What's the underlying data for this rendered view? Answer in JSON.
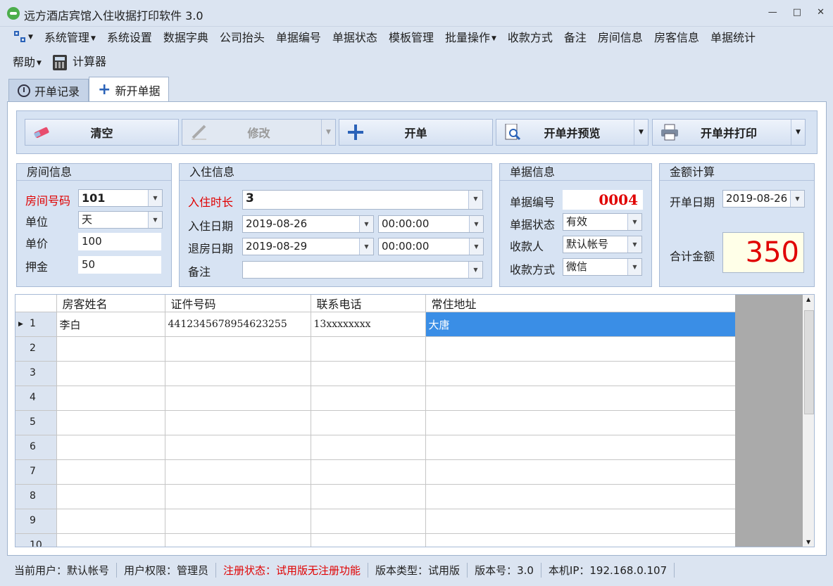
{
  "window": {
    "title": "远方酒店宾馆入住收据打印软件 3.0"
  },
  "menu": {
    "row1": [
      "系统管理",
      "系统设置",
      "数据字典",
      "公司抬头",
      "单据编号",
      "单据状态",
      "模板管理",
      "批量操作",
      "收款方式",
      "备注",
      "房间信息",
      "房客信息",
      "单据统计"
    ],
    "help": "帮助",
    "calculator": "计算器"
  },
  "tabs": [
    {
      "label": "开单记录"
    },
    {
      "label": "新开单据"
    }
  ],
  "toolbar": {
    "clear": "清空",
    "modify": "修改",
    "open": "开单",
    "open_preview": "开单并预览",
    "open_print": "开单并打印"
  },
  "room": {
    "title": "房间信息",
    "room_no_label": "房间号码",
    "room_no": "101",
    "unit_label": "单位",
    "unit": "天",
    "price_label": "单价",
    "price": "100",
    "deposit_label": "押金",
    "deposit": "50"
  },
  "stay": {
    "title": "入住信息",
    "duration_label": "入住时长",
    "duration": "3",
    "checkin_label": "入住日期",
    "checkin_date": "2019-08-26",
    "checkin_time": "00:00:00",
    "checkout_label": "退房日期",
    "checkout_date": "2019-08-29",
    "checkout_time": "00:00:00",
    "remark_label": "备注",
    "remark": ""
  },
  "receipt": {
    "title": "单据信息",
    "no_label": "单据编号",
    "no": "0004",
    "status_label": "单据状态",
    "status": "有效",
    "payee_label": "收款人",
    "payee": "默认帐号",
    "method_label": "收款方式",
    "method": "微信"
  },
  "amount": {
    "title": "金额计算",
    "date_label": "开单日期",
    "date": "2019-08-26",
    "total_label": "合计金额",
    "total": "350"
  },
  "grid": {
    "columns": [
      "房客姓名",
      "证件号码",
      "联系电话",
      "常住地址"
    ],
    "rows": [
      {
        "n": "1",
        "name": "李白",
        "id": "4412345678954623255",
        "phone": "13xxxxxxxx",
        "address": "大唐"
      },
      {
        "n": "2",
        "name": "",
        "id": "",
        "phone": "",
        "address": ""
      },
      {
        "n": "3",
        "name": "",
        "id": "",
        "phone": "",
        "address": ""
      },
      {
        "n": "4",
        "name": "",
        "id": "",
        "phone": "",
        "address": ""
      },
      {
        "n": "5",
        "name": "",
        "id": "",
        "phone": "",
        "address": ""
      },
      {
        "n": "6",
        "name": "",
        "id": "",
        "phone": "",
        "address": ""
      },
      {
        "n": "7",
        "name": "",
        "id": "",
        "phone": "",
        "address": ""
      },
      {
        "n": "8",
        "name": "",
        "id": "",
        "phone": "",
        "address": ""
      },
      {
        "n": "9",
        "name": "",
        "id": "",
        "phone": "",
        "address": ""
      },
      {
        "n": "10",
        "name": "",
        "id": "",
        "phone": "",
        "address": ""
      }
    ]
  },
  "status": {
    "user": "当前用户：默认帐号",
    "permission": "用户权限：管理员",
    "register": "注册状态：试用版无注册功能",
    "edition": "版本类型：试用版",
    "version": "版本号：3.0",
    "ip": "本机IP：192.168.0.107"
  }
}
